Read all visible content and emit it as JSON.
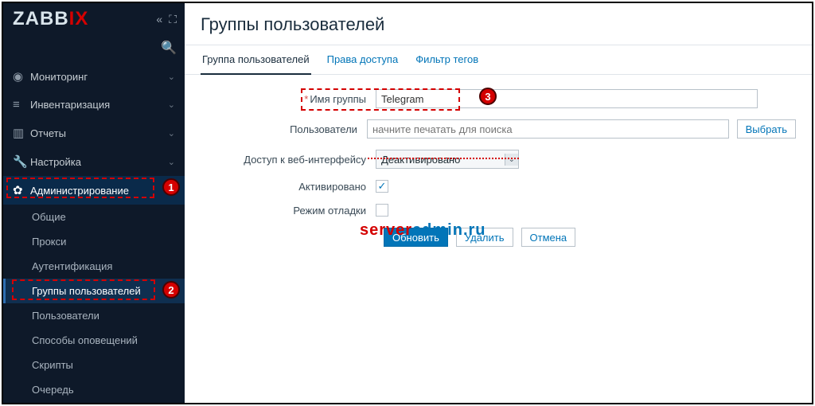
{
  "brand": {
    "part1": "ZABB",
    "part2": "IX"
  },
  "sidebar": {
    "items": [
      {
        "label": "Мониторинг"
      },
      {
        "label": "Инвентаризация"
      },
      {
        "label": "Отчеты"
      },
      {
        "label": "Настройка"
      },
      {
        "label": "Администрирование"
      }
    ],
    "admin_sub": [
      {
        "label": "Общие"
      },
      {
        "label": "Прокси"
      },
      {
        "label": "Аутентификация"
      },
      {
        "label": "Группы пользователей"
      },
      {
        "label": "Пользователи"
      },
      {
        "label": "Способы оповещений"
      },
      {
        "label": "Скрипты"
      },
      {
        "label": "Очередь"
      }
    ]
  },
  "page": {
    "title": "Группы пользователей"
  },
  "tabs": [
    {
      "label": "Группа пользователей"
    },
    {
      "label": "Права доступа"
    },
    {
      "label": "Фильтр тегов"
    }
  ],
  "form": {
    "group_name_label": "Имя группы",
    "group_name_value": "Telegram",
    "users_label": "Пользователи",
    "users_placeholder": "начните печатать для поиска",
    "select_btn": "Выбрать",
    "frontend_label": "Доступ к веб-интерфейсу",
    "frontend_value": "Деактивировано",
    "enabled_label": "Активировано",
    "debug_label": "Режим отладки"
  },
  "actions": {
    "update": "Обновить",
    "delete": "Удалить",
    "cancel": "Отмена"
  },
  "watermark": {
    "a": "server",
    "b": "admin.ru"
  },
  "annotations": {
    "b1": "1",
    "b2": "2",
    "b3": "3"
  }
}
